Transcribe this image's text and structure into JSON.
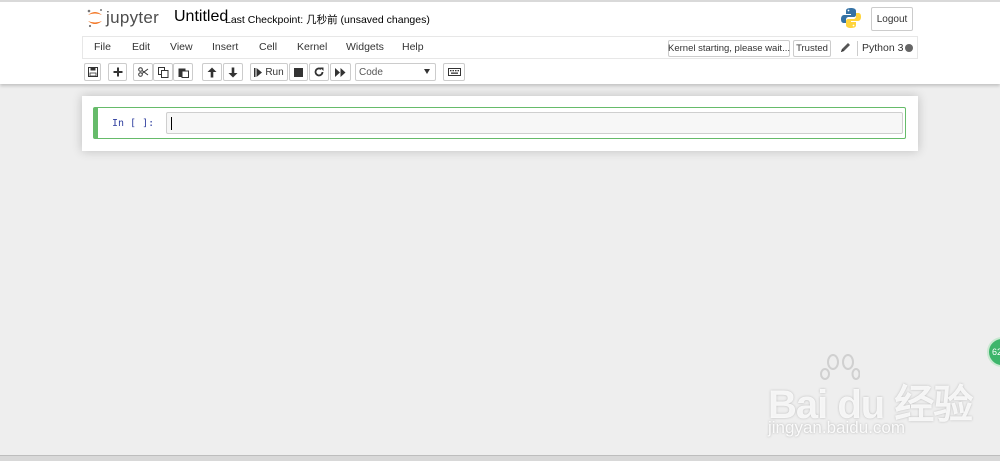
{
  "header": {
    "logo_text": "jupyter",
    "notebook_title": "Untitled",
    "checkpoint_text": "Last Checkpoint: 几秒前   (unsaved changes)",
    "logout_label": "Logout"
  },
  "menu": {
    "items": [
      "File",
      "Edit",
      "View",
      "Insert",
      "Cell",
      "Kernel",
      "Widgets",
      "Help"
    ],
    "kernel_status": "Kernel starting, please wait...",
    "trusted_label": "Trusted",
    "kernel_name": "Python 3"
  },
  "toolbar": {
    "run_label": "Run",
    "cell_type": "Code",
    "icons": [
      "save-icon",
      "plus-icon",
      "scissors-icon",
      "copy-icon",
      "paste-icon",
      "arrow-up-icon",
      "arrow-down-icon",
      "step-forward-icon",
      "stop-icon",
      "refresh-icon",
      "fast-forward-icon",
      "keyboard-icon"
    ]
  },
  "cell": {
    "prompt": "In [ ]:",
    "content": ""
  },
  "floating_badge": "62",
  "watermark": {
    "text": "Bai du 经验",
    "url": "jingyan.baidu.com"
  },
  "colors": {
    "cell_border": "#66bb6a",
    "prompt": "#303f9f",
    "jupyter_orange": "#f37726"
  }
}
